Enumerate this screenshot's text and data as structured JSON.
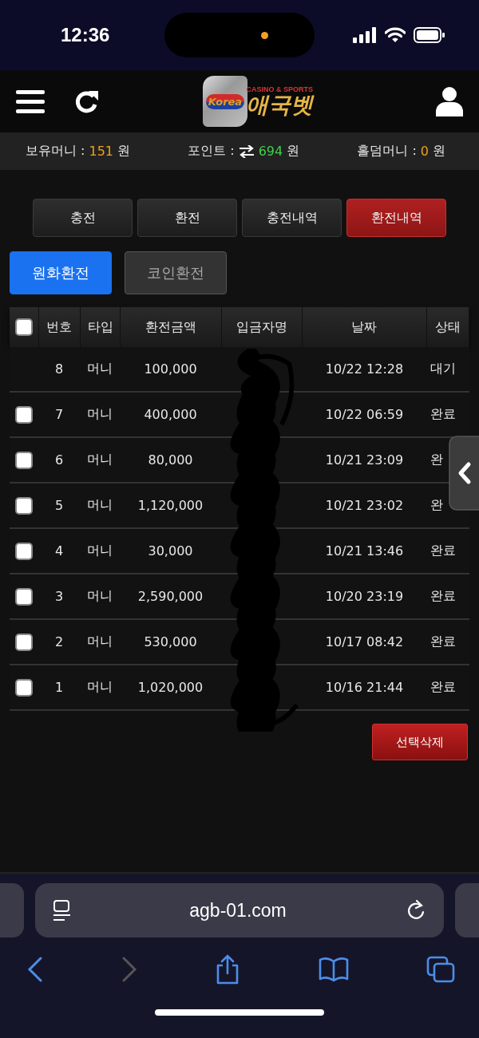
{
  "status_bar": {
    "time": "12:36"
  },
  "header": {
    "logo": {
      "badge": "Korea",
      "tagline": "CASINO & SPORTS",
      "name": "애국벳"
    }
  },
  "balances": [
    {
      "label": "보유머니 :",
      "value": "151",
      "unit": "원",
      "color": "#f0a020",
      "exchange": false
    },
    {
      "label": "포인트 :",
      "value": "694",
      "unit": "원",
      "color": "#3fd14a",
      "exchange": true
    },
    {
      "label": "홀덤머니 :",
      "value": "0",
      "unit": "원",
      "color": "#f0a020",
      "exchange": false
    }
  ],
  "tabs": [
    {
      "label": "충전",
      "selected": false
    },
    {
      "label": "환전",
      "selected": false
    },
    {
      "label": "충전내역",
      "selected": false
    },
    {
      "label": "환전내역",
      "selected": true
    }
  ],
  "sub_tabs": [
    {
      "label": "원화환전",
      "selected": true
    },
    {
      "label": "코인환전",
      "selected": false
    }
  ],
  "table": {
    "header_checked": false,
    "columns": [
      "번호",
      "타입",
      "환전금액",
      "입금자명",
      "날짜",
      "상태"
    ],
    "rows": [
      {
        "selectable": false,
        "no": "8",
        "type": "머니",
        "amount": "100,000",
        "date": "10/22 12:28",
        "status": "대기"
      },
      {
        "selectable": true,
        "checked": false,
        "no": "7",
        "type": "머니",
        "amount": "400,000",
        "date": "10/22 06:59",
        "status": "완료"
      },
      {
        "selectable": true,
        "checked": false,
        "no": "6",
        "type": "머니",
        "amount": "80,000",
        "date": "10/21 23:09",
        "status": "완"
      },
      {
        "selectable": true,
        "checked": false,
        "no": "5",
        "type": "머니",
        "amount": "1,120,000",
        "date": "10/21 23:02",
        "status": "완"
      },
      {
        "selectable": true,
        "checked": false,
        "no": "4",
        "type": "머니",
        "amount": "30,000",
        "date": "10/21 13:46",
        "status": "완료"
      },
      {
        "selectable": true,
        "checked": false,
        "no": "3",
        "type": "머니",
        "amount": "2,590,000",
        "date": "10/20 23:19",
        "status": "완료"
      },
      {
        "selectable": true,
        "checked": false,
        "no": "2",
        "type": "머니",
        "amount": "530,000",
        "date": "10/17 08:42",
        "status": "완료"
      },
      {
        "selectable": true,
        "checked": false,
        "no": "1",
        "type": "머니",
        "amount": "1,020,000",
        "date": "10/16 21:44",
        "status": "완료"
      }
    ]
  },
  "delete_button": "선택삭제",
  "browser": {
    "url": "agb-01.com",
    "forward_disabled": true
  }
}
